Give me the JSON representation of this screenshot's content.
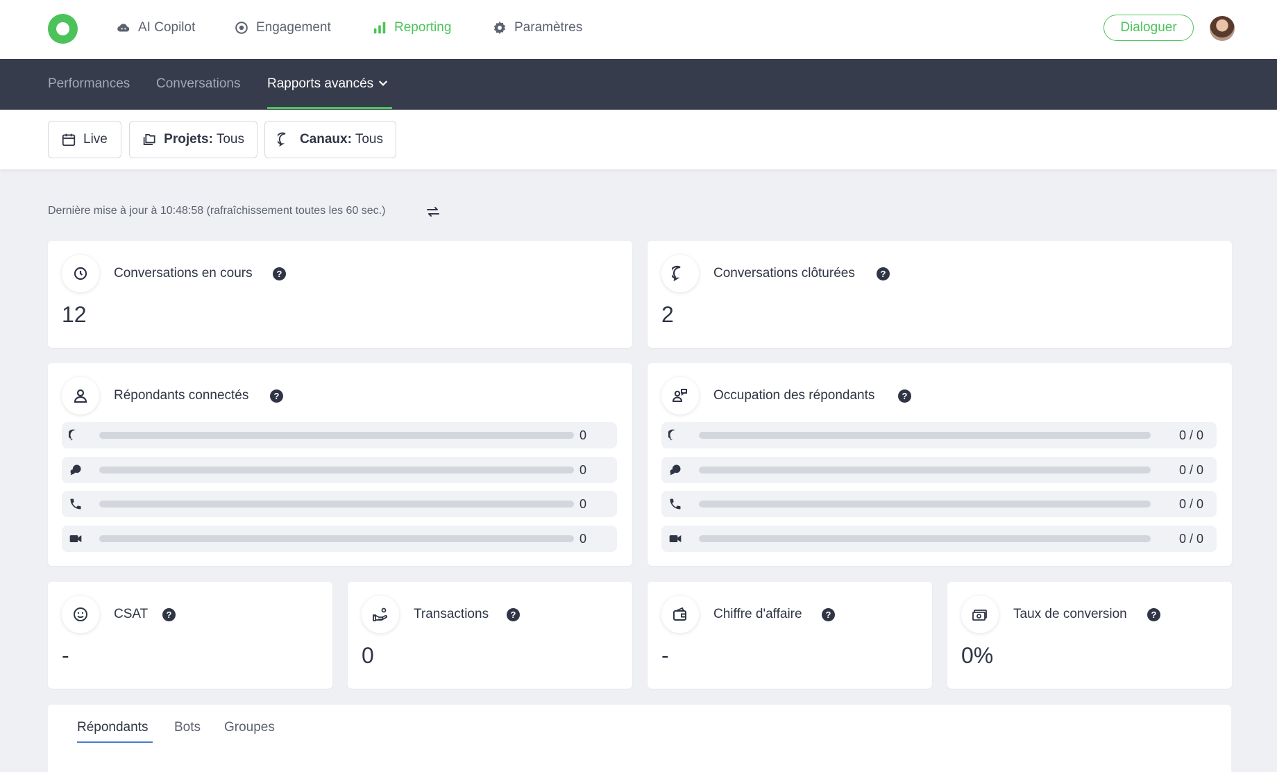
{
  "topnav": {
    "items": [
      {
        "label": "AI Copilot",
        "icon": "cloud-icon"
      },
      {
        "label": "Engagement",
        "icon": "target-icon"
      },
      {
        "label": "Reporting",
        "icon": "bar-chart-icon",
        "active": true
      },
      {
        "label": "Paramètres",
        "icon": "gear-icon"
      }
    ],
    "cta_label": "Dialoguer"
  },
  "subnav": {
    "items": [
      {
        "label": "Performances"
      },
      {
        "label": "Conversations"
      },
      {
        "label": "Rapports avancés",
        "active": true
      }
    ]
  },
  "filters": {
    "live_label": "Live",
    "projects_key": "Projets:",
    "projects_value": "Tous",
    "channels_key": "Canaux:",
    "channels_value": "Tous"
  },
  "update_text": "Dernière mise à jour à 10:48:58 (rafraîchissement toutes les 60 sec.)",
  "cards": {
    "ongoing": {
      "title": "Conversations en cours",
      "value": "12"
    },
    "closed": {
      "title": "Conversations clôturées",
      "value": "2"
    },
    "connected": {
      "title": "Répondants connectés",
      "rows": [
        {
          "icon": "chat-icon",
          "value": "0"
        },
        {
          "icon": "chat-group-icon",
          "value": "0"
        },
        {
          "icon": "phone-icon",
          "value": "0"
        },
        {
          "icon": "video-icon",
          "value": "0"
        }
      ]
    },
    "occupancy": {
      "title": "Occupation des répondants",
      "rows": [
        {
          "icon": "chat-icon",
          "value": "0 / 0"
        },
        {
          "icon": "chat-group-icon",
          "value": "0 / 0"
        },
        {
          "icon": "phone-icon",
          "value": "0 / 0"
        },
        {
          "icon": "video-icon",
          "value": "0 / 0"
        }
      ]
    },
    "csat": {
      "title": "CSAT",
      "value": "-"
    },
    "transactions": {
      "title": "Transactions",
      "value": "0"
    },
    "revenue": {
      "title": "Chiffre d'affaire",
      "value": "-"
    },
    "conversion": {
      "title": "Taux de conversion",
      "value": "0%"
    }
  },
  "bottom_tabs": [
    {
      "label": "Répondants",
      "active": true
    },
    {
      "label": "Bots"
    },
    {
      "label": "Groupes"
    }
  ],
  "colors": {
    "accent_green": "#4cc35a",
    "subnav_bg": "#363c4b",
    "tab_underline": "#4a7bd0"
  }
}
